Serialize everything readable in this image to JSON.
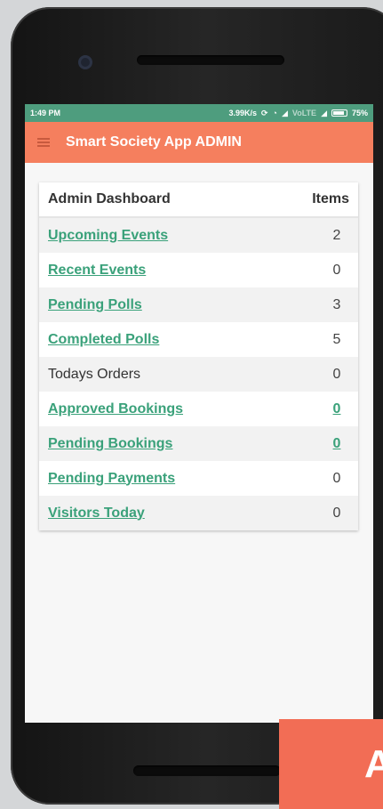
{
  "status_bar": {
    "time": "1:49 PM",
    "network_speed": "3.99K/s",
    "lte_label": "VoLTE",
    "battery": "75%"
  },
  "app_bar": {
    "title": "Smart Society App ADMIN",
    "menu_icon": "hamburger-icon"
  },
  "dashboard": {
    "header": {
      "title": "Admin Dashboard",
      "items_label": "Items"
    },
    "rows": [
      {
        "label": "Upcoming Events",
        "value": "2",
        "link": true,
        "value_link": false
      },
      {
        "label": "Recent Events",
        "value": "0",
        "link": true,
        "value_link": false
      },
      {
        "label": "Pending Polls",
        "value": "3",
        "link": true,
        "value_link": false
      },
      {
        "label": "Completed Polls",
        "value": "5",
        "link": true,
        "value_link": false
      },
      {
        "label": "Todays Orders",
        "value": "0",
        "link": false,
        "value_link": false
      },
      {
        "label": "Approved Bookings",
        "value": "0",
        "link": true,
        "value_link": true
      },
      {
        "label": "Pending Bookings",
        "value": "0",
        "link": true,
        "value_link": true
      },
      {
        "label": "Pending Payments",
        "value": "0",
        "link": true,
        "value_link": false
      },
      {
        "label": "Visitors Today",
        "value": "0",
        "link": true,
        "value_link": false
      }
    ]
  },
  "overlay_text": "A",
  "colors": {
    "status_bar": "#4e9d7e",
    "app_bar": "#f57f5e",
    "link": "#3aa17a",
    "overlay": "#f26d55"
  }
}
